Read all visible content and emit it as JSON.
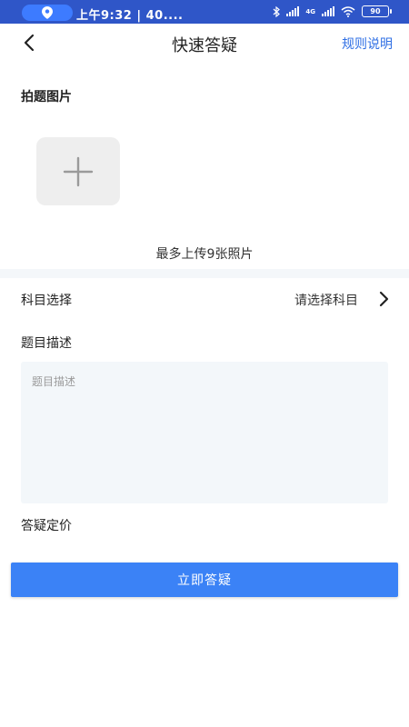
{
  "status_bar": {
    "time": "上午9:32 | 40....",
    "battery": "90",
    "network_label": "4G",
    "colors": {
      "background": "#2f56c8",
      "pill": "#3d7bff"
    }
  },
  "header": {
    "title": "快速答疑",
    "rules_link": "规则说明",
    "icons": {
      "back": "back-arrow-icon"
    }
  },
  "photo": {
    "label": "拍题图片",
    "add_icon": "plus-icon",
    "hint": "最多上传9张照片"
  },
  "subject": {
    "label": "科目选择",
    "value": "请选择科目",
    "icon": "chevron-right-icon"
  },
  "description": {
    "label": "题目描述",
    "placeholder": "题目描述",
    "value": ""
  },
  "price": {
    "label": "答疑定价"
  },
  "submit": {
    "label": "立即答疑",
    "color": "#3b82f6"
  },
  "accent_color": "#2f6fe4"
}
